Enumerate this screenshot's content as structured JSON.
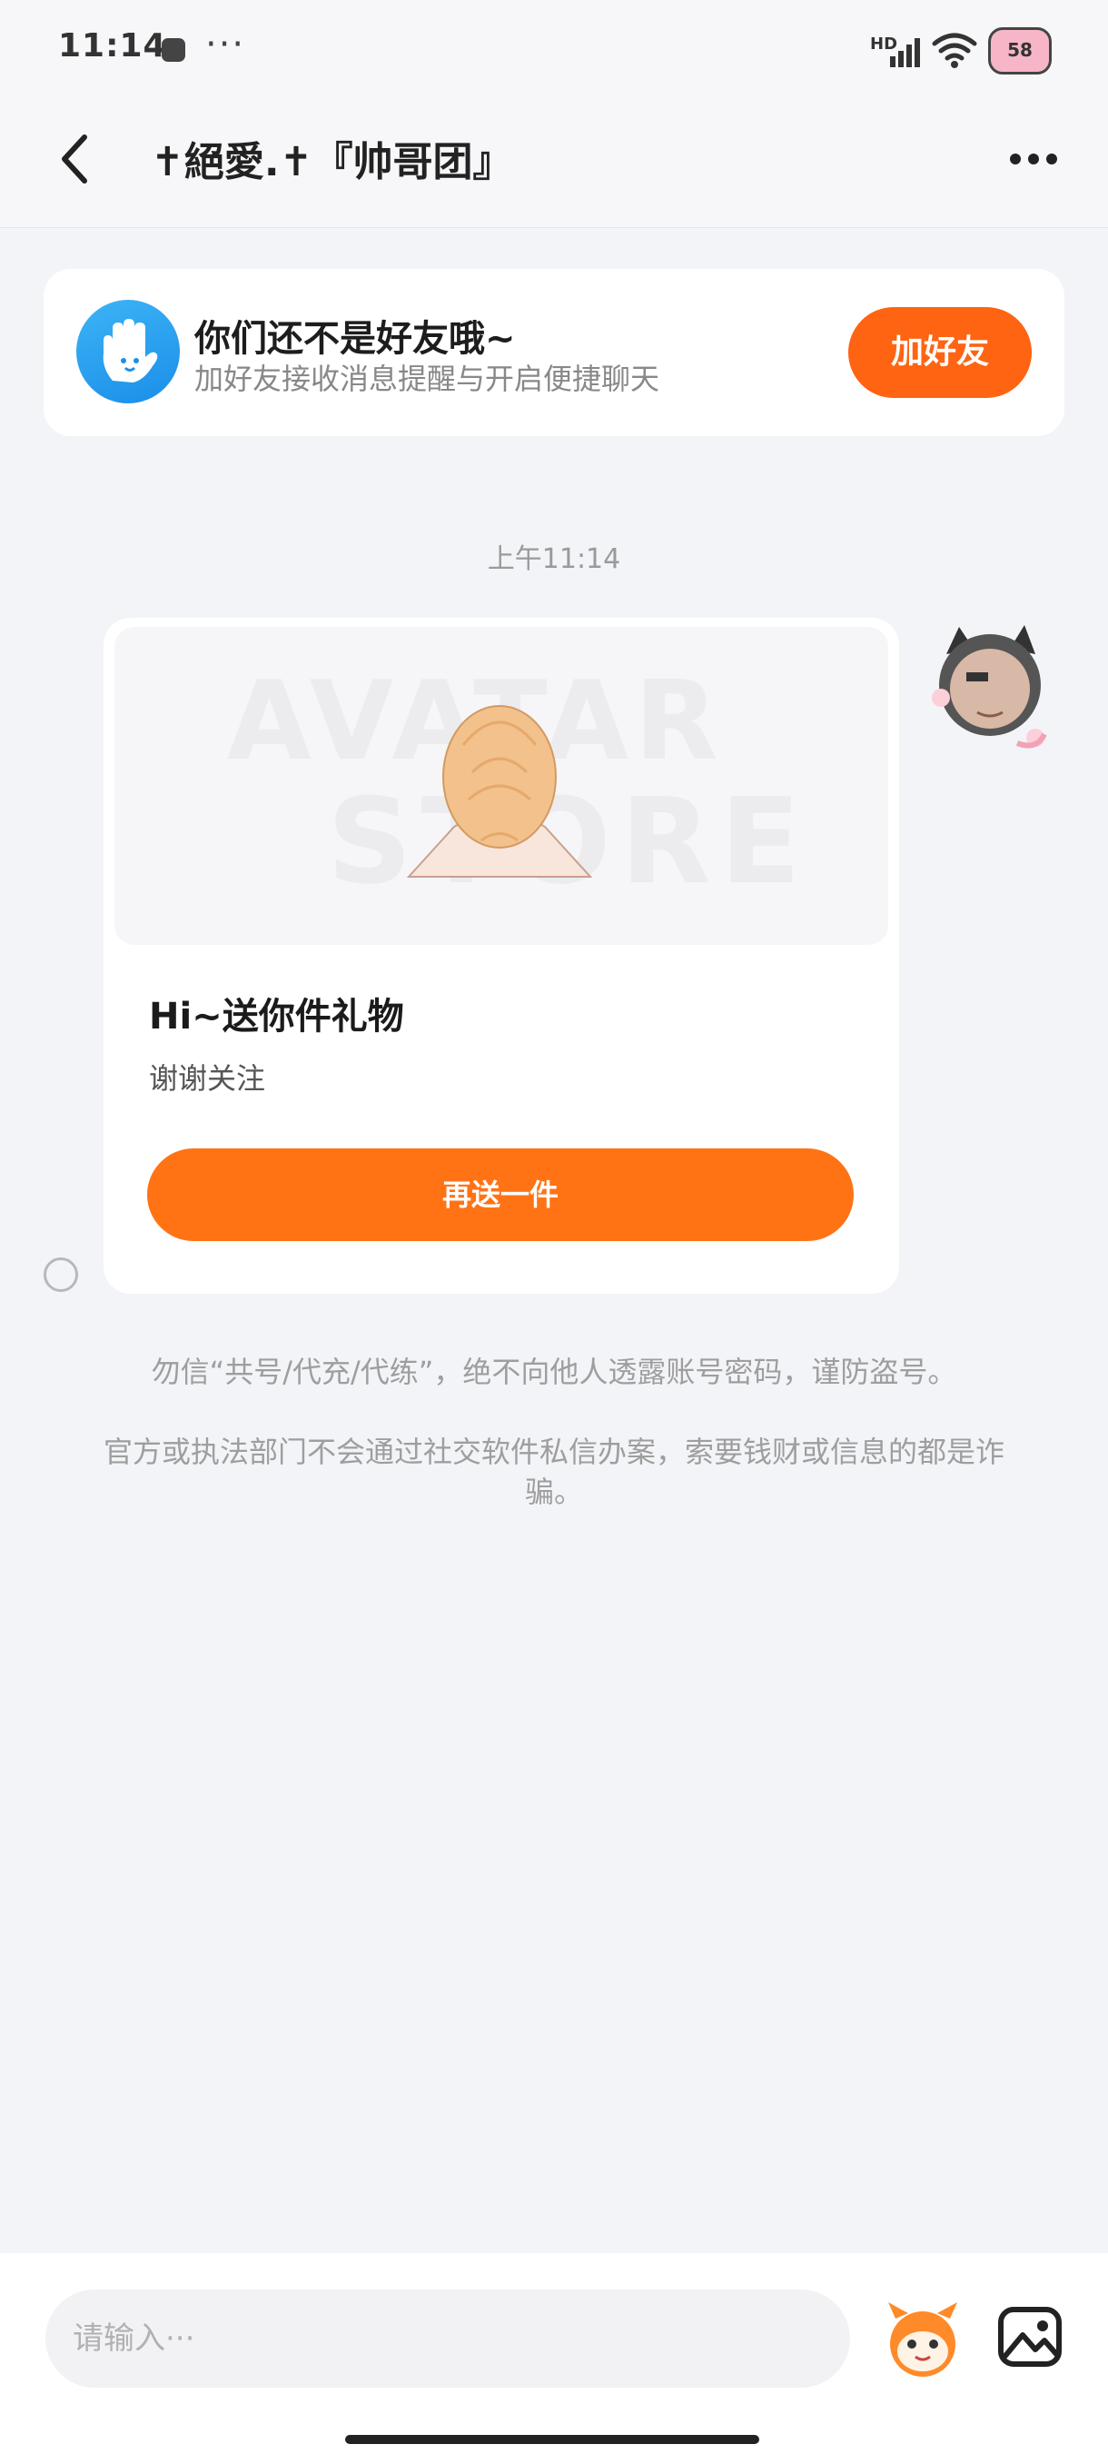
{
  "status_bar": {
    "time": "11:14",
    "dots": "···",
    "network_badge": "HD",
    "battery_level": "58"
  },
  "header": {
    "title": "✝絕愛.✝『帅哥团』"
  },
  "friend_banner": {
    "title": "你们还不是好友哦~",
    "subtitle": "加好友接收消息提醒与开启便捷聊天",
    "add_button_label": "加好友"
  },
  "chat": {
    "timestamp": "上午11:14",
    "gift_card": {
      "watermark_line1": "AVATAR",
      "watermark_line2": "STORE",
      "title": "Hi~送你件礼物",
      "subtitle": "谢谢关注",
      "button_label": "再送一件"
    },
    "notice_1": "勿信“共号/代充/代练”，绝不向他人透露账号密码，谨防盗号。",
    "notice_2": "官方或执法部门不会通过社交软件私信办案，索要钱财或信息的都是诈骗。"
  },
  "composer": {
    "placeholder": "请输入···"
  },
  "colors": {
    "accent": "#ff6412",
    "banner_icon": "#1b8ee8",
    "background": "#f3f4f8"
  },
  "icons": [
    "back-arrow-icon",
    "more-icon",
    "wave-hand-icon",
    "wifi-icon",
    "signal-icon",
    "mascot-icon",
    "image-icon"
  ]
}
